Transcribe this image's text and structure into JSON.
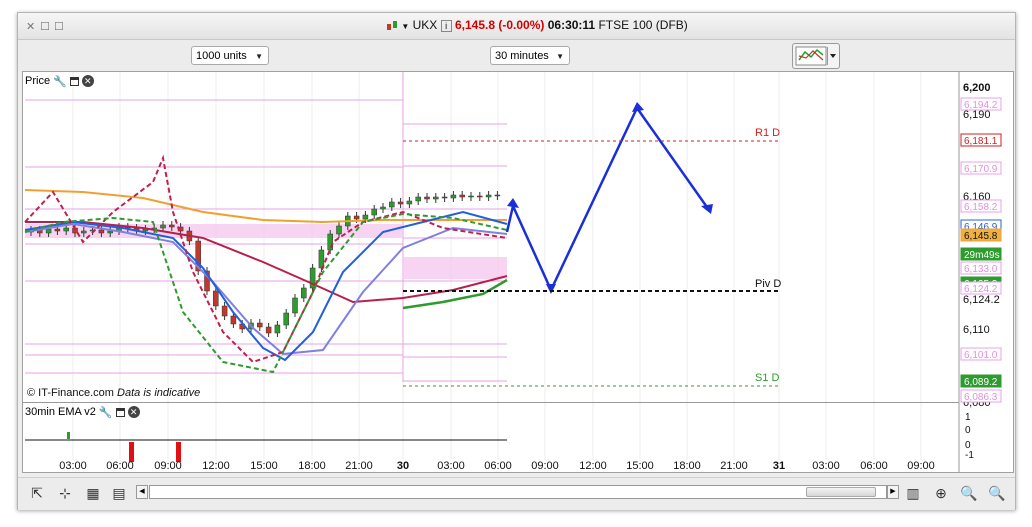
{
  "window": {
    "controls": [
      "✕",
      "☐",
      "☐"
    ]
  },
  "title": {
    "symbol": "UKX",
    "price_change": "6,145.8 (-0.00%)",
    "time": "06:30:11",
    "instrument": "FTSE 100 (DFB)"
  },
  "toolbar": {
    "units": "1000 units",
    "interval": "30 minutes"
  },
  "price_panel": {
    "label": "Price",
    "watermark_brand": "© IT-Finance.com",
    "watermark_note": "Data is indicative"
  },
  "ema_panel": {
    "label": "30min EMA v2",
    "axis": [
      "1",
      "0",
      "0",
      "-1"
    ]
  },
  "levels": {
    "r1": "R1 D",
    "piv": "Piv D",
    "s1": "S1 D"
  },
  "price_axis": {
    "ticks": [
      "6,200",
      "6,190",
      "6,160",
      "6,124.2",
      "6,110",
      "6,080"
    ],
    "tags": [
      {
        "text": "6,194.2",
        "style": "pink"
      },
      {
        "text": "6,181.1",
        "style": "red"
      },
      {
        "text": "6,170.9",
        "style": "pink"
      },
      {
        "text": "6,158.2",
        "style": "pink"
      },
      {
        "text": "6,146.9",
        "style": "blue"
      },
      {
        "text": "6,145.8",
        "style": "orange"
      },
      {
        "text": "29m49s",
        "style": "green"
      },
      {
        "text": "6,133.0",
        "style": "pink"
      },
      {
        "text": "6,125.3",
        "style": "green"
      },
      {
        "text": "6,124.2",
        "style": "pink"
      },
      {
        "text": "6,101.0",
        "style": "pink"
      },
      {
        "text": "6,089.2",
        "style": "green"
      },
      {
        "text": "6,086.3",
        "style": "pink"
      }
    ]
  },
  "time_axis": [
    "03:00",
    "06:00",
    "09:00",
    "12:00",
    "15:00",
    "18:00",
    "21:00",
    "30",
    "03:00",
    "06:00",
    "09:00",
    "12:00",
    "15:00",
    "18:00",
    "21:00",
    "31",
    "03:00",
    "06:00",
    "09:00"
  ],
  "colors": {
    "up": "#2e9b2e",
    "down": "#c0392b",
    "pivot_pink": "#e8a3e8",
    "ma_orange": "#f0a030",
    "ma_red": "#b8204a",
    "ma_blue": "#2060e0",
    "ma_lilac": "#8080e0",
    "arrow": "#1a2fd8"
  },
  "icons": [
    "wrench-icon",
    "window-icon",
    "close-icon",
    "chart-type-icon",
    "zoom-in-icon",
    "zoom-out-icon"
  ]
}
